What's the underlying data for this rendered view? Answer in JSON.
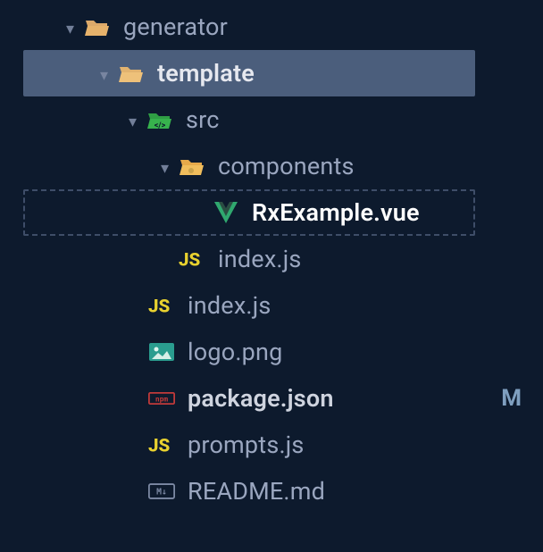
{
  "tree": {
    "items": [
      {
        "label": "generator",
        "indent": 74,
        "chevron": "open",
        "icon": "folder-open",
        "selected": false,
        "dashed": false,
        "labelClass": ""
      },
      {
        "label": "template",
        "indent": 112,
        "chevron": "open",
        "icon": "folder-open-alt",
        "selected": true,
        "dashed": false,
        "labelClass": ""
      },
      {
        "label": "src",
        "indent": 144,
        "chevron": "open",
        "icon": "folder-src",
        "selected": false,
        "dashed": false,
        "labelClass": ""
      },
      {
        "label": "components",
        "indent": 180,
        "chevron": "open",
        "icon": "folder-components",
        "selected": false,
        "dashed": false,
        "labelClass": ""
      },
      {
        "label": "RxExample.vue",
        "indent": 216,
        "chevron": "none",
        "icon": "vue",
        "selected": false,
        "dashed": true,
        "labelClass": ""
      },
      {
        "label": "index.js",
        "indent": 180,
        "chevron": "none",
        "icon": "js",
        "selected": false,
        "dashed": false,
        "labelClass": ""
      },
      {
        "label": "index.js",
        "indent": 146,
        "chevron": "none",
        "icon": "js",
        "selected": false,
        "dashed": false,
        "labelClass": ""
      },
      {
        "label": "logo.png",
        "indent": 146,
        "chevron": "none",
        "icon": "image",
        "selected": false,
        "dashed": false,
        "labelClass": ""
      },
      {
        "label": "package.json",
        "indent": 146,
        "chevron": "none",
        "icon": "npm",
        "selected": false,
        "dashed": false,
        "labelClass": "file-bold",
        "status": "M"
      },
      {
        "label": "prompts.js",
        "indent": 146,
        "chevron": "none",
        "icon": "js",
        "selected": false,
        "dashed": false,
        "labelClass": ""
      },
      {
        "label": "README.md",
        "indent": 146,
        "chevron": "none",
        "icon": "md",
        "selected": false,
        "dashed": false,
        "labelClass": ""
      }
    ]
  },
  "icons": {
    "js_text": "JS",
    "md_text": "M↓"
  },
  "colors": {
    "folder": "#dca96a",
    "folderAlt": "#e2b36f",
    "folderSrc": "#2f9e44",
    "folderComp": "#e6a94a",
    "vue": "#30a86f",
    "js": "#e8d12f",
    "image": "#2a9d8f",
    "npm": "#c23a3a",
    "md": "#7d8aa5"
  }
}
